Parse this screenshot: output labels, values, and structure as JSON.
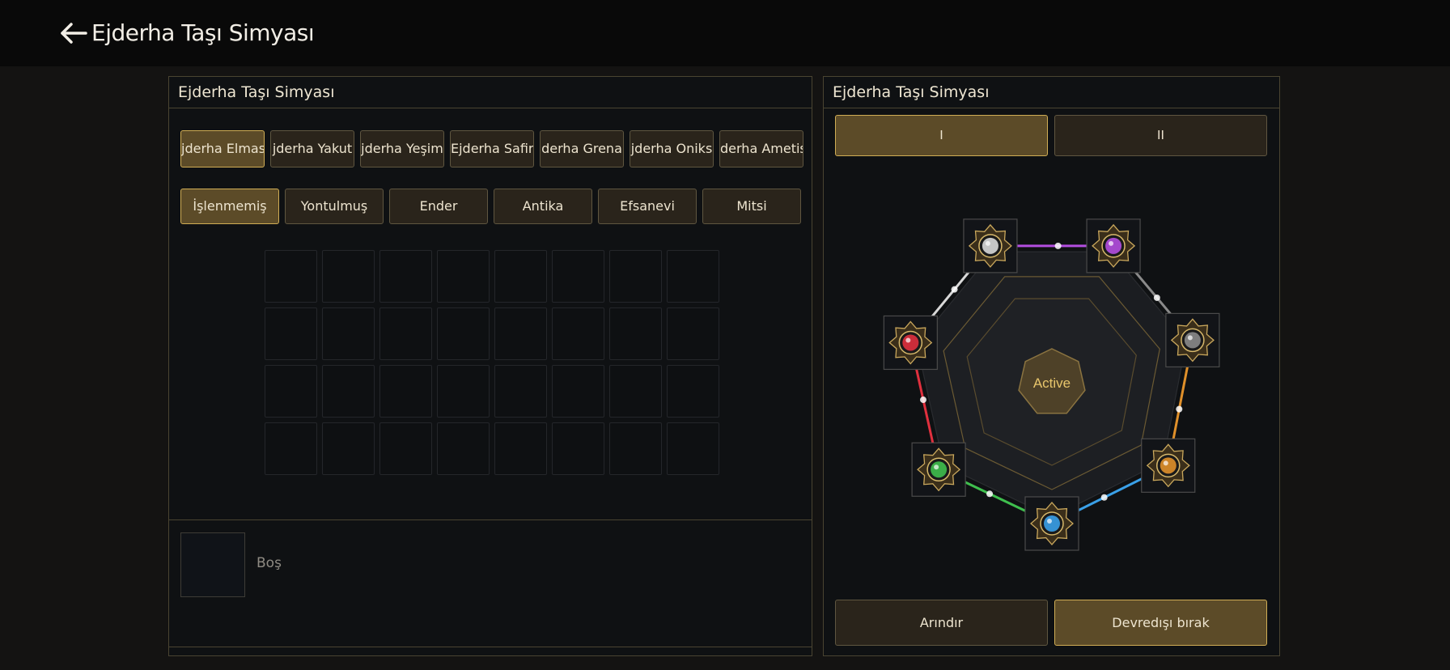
{
  "header": {
    "title": "Ejderha Taşı Simyası"
  },
  "left_panel": {
    "title": "Ejderha Taşı Simyası",
    "gem_tabs": [
      {
        "label": "jderha Elmas"
      },
      {
        "label": "jderha Yakut"
      },
      {
        "label": "jderha Yeşim"
      },
      {
        "label": "Ejderha Safir"
      },
      {
        "label": "derha Grena"
      },
      {
        "label": "jderha Oniks"
      },
      {
        "label": "derha Ametis"
      }
    ],
    "grade_tabs": [
      {
        "label": "İşlenmemiş"
      },
      {
        "label": "Yontulmuş"
      },
      {
        "label": "Ender"
      },
      {
        "label": "Antika"
      },
      {
        "label": "Efsanevi"
      },
      {
        "label": "Mitsi"
      }
    ],
    "grid": {
      "rows": 4,
      "cols": 8
    },
    "detail": {
      "label": "Boş"
    }
  },
  "right_panel": {
    "title": "Ejderha Taşı Simyası",
    "page_tabs": [
      {
        "label": "I"
      },
      {
        "label": "II"
      }
    ],
    "center_label": "Active",
    "sockets": [
      {
        "name": "white-gem-socket",
        "color": "#d8d8d8"
      },
      {
        "name": "purple-gem-socket",
        "color": "#b44ee0"
      },
      {
        "name": "gray-gem-socket",
        "color": "#8a8a8a"
      },
      {
        "name": "amber-gem-socket",
        "color": "#e0902a"
      },
      {
        "name": "blue-gem-socket",
        "color": "#3aa0e8"
      },
      {
        "name": "green-gem-socket",
        "color": "#3fbf4e"
      },
      {
        "name": "red-gem-socket",
        "color": "#e0303e"
      }
    ],
    "actions": {
      "purify": "Arındır",
      "deactivate": "Devredışı bırak"
    }
  },
  "colors": {
    "accent_gold": "#d0ad55",
    "active_fill": "#5c4b28",
    "button_fill": "#2a241b"
  }
}
